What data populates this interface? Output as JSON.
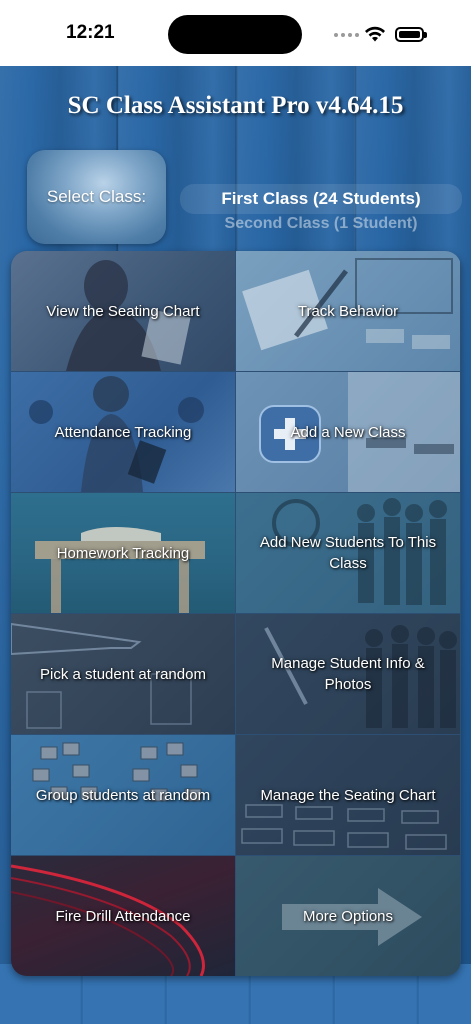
{
  "status_bar": {
    "time": "12:21"
  },
  "app": {
    "title": "SC Class Assistant Pro v4.64.15"
  },
  "class_selector": {
    "button_label": "Select Class:",
    "selected_option": "First Class (24 Students)",
    "next_option": "Second Class (1 Student)"
  },
  "menu": {
    "view_seating_chart": "View the Seating Chart",
    "track_behavior": "Track Behavior",
    "attendance_tracking": "Attendance Tracking",
    "add_new_class": "Add a New Class",
    "homework_tracking": "Homework Tracking",
    "add_new_students": "Add New Students To This Class",
    "pick_random_student": "Pick a student at random",
    "manage_student_info": "Manage Student Info & Photos",
    "group_students_random": "Group students at random",
    "manage_seating_chart": "Manage the Seating Chart",
    "fire_drill_attendance": "Fire Drill Attendance",
    "more_options": "More Options"
  },
  "colors": {
    "background": "#2563a2",
    "grid_border": "#2e4f74",
    "text": "#ffffff"
  }
}
